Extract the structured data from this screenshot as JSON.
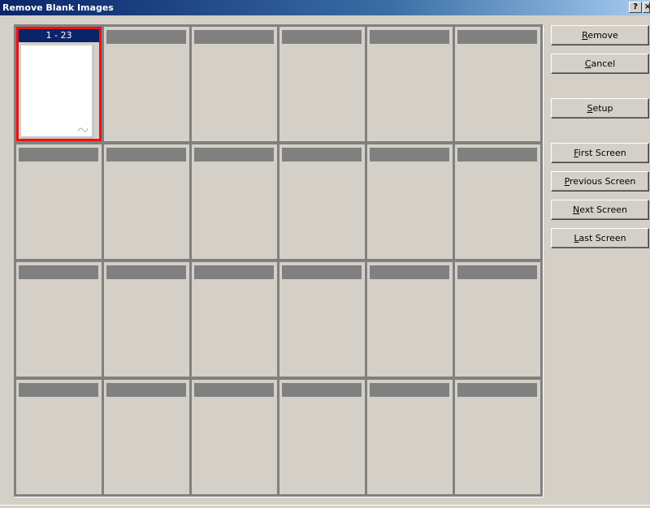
{
  "window": {
    "title": "Remove Blank Images",
    "help_label": "?",
    "close_label": "×"
  },
  "thumbnails": [
    {
      "label": "1 - 23",
      "selected": true,
      "has_image": true
    },
    {
      "label": "",
      "selected": false,
      "has_image": false
    },
    {
      "label": "",
      "selected": false,
      "has_image": false
    },
    {
      "label": "",
      "selected": false,
      "has_image": false
    },
    {
      "label": "",
      "selected": false,
      "has_image": false
    },
    {
      "label": "",
      "selected": false,
      "has_image": false
    },
    {
      "label": "",
      "selected": false,
      "has_image": false
    },
    {
      "label": "",
      "selected": false,
      "has_image": false
    },
    {
      "label": "",
      "selected": false,
      "has_image": false
    },
    {
      "label": "",
      "selected": false,
      "has_image": false
    },
    {
      "label": "",
      "selected": false,
      "has_image": false
    },
    {
      "label": "",
      "selected": false,
      "has_image": false
    },
    {
      "label": "",
      "selected": false,
      "has_image": false
    },
    {
      "label": "",
      "selected": false,
      "has_image": false
    },
    {
      "label": "",
      "selected": false,
      "has_image": false
    },
    {
      "label": "",
      "selected": false,
      "has_image": false
    },
    {
      "label": "",
      "selected": false,
      "has_image": false
    },
    {
      "label": "",
      "selected": false,
      "has_image": false
    },
    {
      "label": "",
      "selected": false,
      "has_image": false
    },
    {
      "label": "",
      "selected": false,
      "has_image": false
    },
    {
      "label": "",
      "selected": false,
      "has_image": false
    },
    {
      "label": "",
      "selected": false,
      "has_image": false
    },
    {
      "label": "",
      "selected": false,
      "has_image": false
    },
    {
      "label": "",
      "selected": false,
      "has_image": false
    }
  ],
  "buttons": {
    "remove": {
      "key": "R",
      "rest": "emove"
    },
    "cancel": {
      "key": "C",
      "rest": "ancel"
    },
    "setup": {
      "key": "S",
      "rest": "etup"
    },
    "first": {
      "key": "F",
      "rest": "irst Screen"
    },
    "previous": {
      "key": "P",
      "rest": "revious Screen"
    },
    "next": {
      "key": "N",
      "rest": "ext Screen"
    },
    "last": {
      "key": "L",
      "rest": "ast Screen"
    }
  },
  "colors": {
    "title_bar": "#0a246a",
    "selection_border": "#ee1111",
    "face": "#d4d0c8"
  }
}
